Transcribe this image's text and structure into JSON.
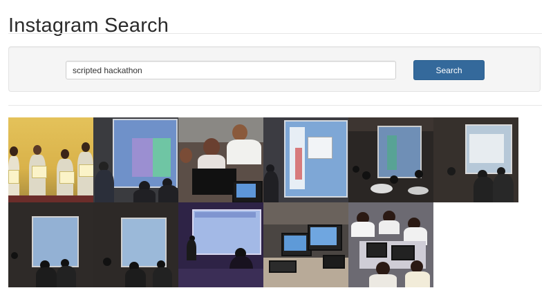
{
  "page": {
    "title": "Instagram Search"
  },
  "search": {
    "query": "scripted hackathon",
    "button_label": "Search"
  },
  "results": {
    "photos": [
      {
        "subject": "students holding certificates"
      },
      {
        "subject": "projector screen presentation"
      },
      {
        "subject": "students working on laptops"
      },
      {
        "subject": "projector screen presentation"
      },
      {
        "subject": "presentation in dark room"
      },
      {
        "subject": "presentation in dark room"
      },
      {
        "subject": "presentation in dark room"
      },
      {
        "subject": "presentation in dark room"
      },
      {
        "subject": "presenter at projector screen"
      },
      {
        "subject": "laptops on table"
      },
      {
        "subject": "students working on laptops"
      }
    ]
  },
  "colors": {
    "button": "#34699b",
    "well": "#f5f5f5"
  }
}
